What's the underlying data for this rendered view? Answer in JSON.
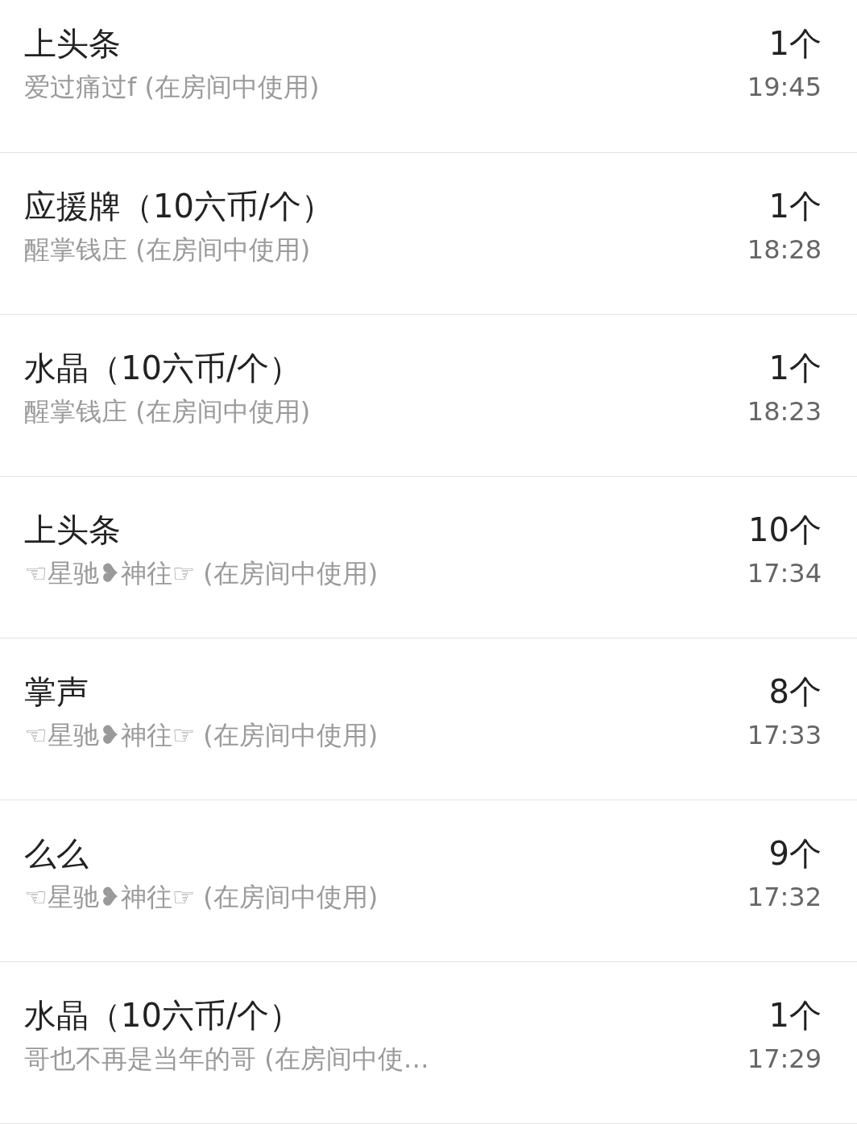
{
  "records": [
    {
      "gift": "上头条",
      "sender": "爱过痛过f (在房间中使用)",
      "count": "1个",
      "time": "19:45"
    },
    {
      "gift": "应援牌（10六币/个）",
      "sender": "醒掌钱庄 (在房间中使用)",
      "count": "1个",
      "time": "18:28"
    },
    {
      "gift": "水晶（10六币/个）",
      "sender": "醒掌钱庄 (在房间中使用)",
      "count": "1个",
      "time": "18:23"
    },
    {
      "gift": "上头条",
      "sender": "☜星驰❥神往☞ (在房间中使用)",
      "count": "10个",
      "time": "17:34"
    },
    {
      "gift": "掌声",
      "sender": "☜星驰❥神往☞ (在房间中使用)",
      "count": "8个",
      "time": "17:33"
    },
    {
      "gift": "么么",
      "sender": "☜星驰❥神往☞ (在房间中使用)",
      "count": "9个",
      "time": "17:32"
    },
    {
      "gift": "水晶（10六币/个）",
      "sender": "哥也不再是当年的哥 (在房间中使…",
      "count": "1个",
      "time": "17:29"
    }
  ]
}
